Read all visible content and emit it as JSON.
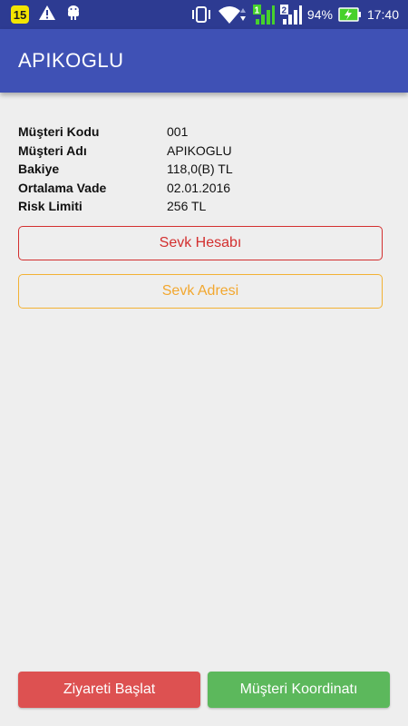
{
  "status_bar": {
    "notification_badge": "15",
    "battery_percent": "94%",
    "time": "17:40",
    "sim1_label": "1",
    "sim2_label": "2",
    "colors": {
      "background": "#2d3b92",
      "badge": "#f3e500",
      "battery_charge": "#46d12c"
    },
    "icons": [
      "number-badge-icon",
      "warning-icon",
      "android-debug-icon",
      "vibrate-icon",
      "wifi-icon",
      "signal-icon",
      "battery-charging-icon"
    ]
  },
  "app_bar": {
    "title": "APIKOGLU",
    "color": "#3f51b5"
  },
  "customer": {
    "rows": [
      {
        "label": "Müşteri Kodu",
        "value": "001"
      },
      {
        "label": "Müşteri Adı",
        "value": "APIKOGLU"
      },
      {
        "label": "Bakiye",
        "value": "118,0(B) TL"
      },
      {
        "label": "Ortalama Vade",
        "value": "02.01.2016"
      },
      {
        "label": "Risk Limiti",
        "value": "256 TL"
      }
    ]
  },
  "actions": {
    "sevk_hesabi": "Sevk Hesabı",
    "sevk_adresi": "Sevk Adresi",
    "ziyareti_baslat": "Ziyareti Başlat",
    "musteri_koordinati": "Müşteri Koordinatı"
  },
  "colors": {
    "danger": "#d32f2f",
    "warning": "#f2a72f",
    "start_visit": "#dd5151",
    "coordinates": "#5cb85c",
    "background": "#eeeeee"
  }
}
